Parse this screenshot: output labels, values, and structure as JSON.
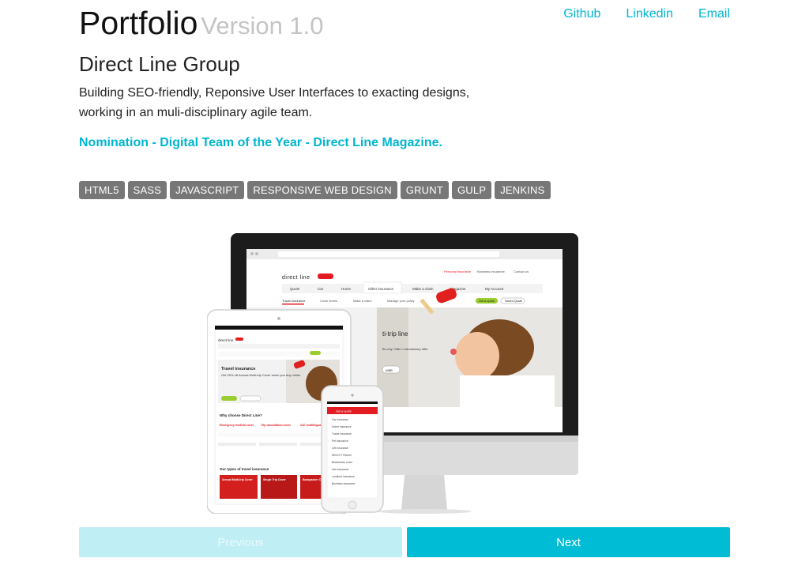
{
  "header": {
    "title": "Portfolio",
    "version": "Version 1.0",
    "links": [
      "Github",
      "Linkedin",
      "Email"
    ]
  },
  "project": {
    "company": "Direct Line Group",
    "description": "Building SEO-friendly, Reponsive User Interfaces to exacting designs, working in an muli-disciplinary agile team.",
    "award": "Nomination - Digital Team of the Year - Direct Line Magazine.",
    "tags": [
      "HTML5",
      "SASS",
      "JAVASCRIPT",
      "RESPONSIVE WEB DESIGN",
      "GRUNT",
      "GULP",
      "JENKINS"
    ]
  },
  "mockup": {
    "logo": "direct line",
    "nav": [
      "Quote",
      "Car",
      "Home",
      "Other insurance",
      "Make a claim",
      "Magazine",
      "My Account"
    ],
    "subnav": [
      "Travel insurance",
      "Cover levels",
      "Make a claim",
      "Manage your policy"
    ],
    "top_links": [
      "Personal insurance",
      "Business insurance",
      "Contact us"
    ],
    "get_quote": "Get a quote",
    "saved_quote": "Saved Quote",
    "hero_fragment": "ti-trip\nline",
    "hero_offer": "ffs only. Offer\nn introductory offer",
    "hero_btn": "uote",
    "tablet": {
      "hero_title": "Travel insurance",
      "hero_text": "Get 25% off Annual Multi-trip Cover when you buy online",
      "why_heading": "Why choose Direct Line?",
      "features": [
        "Emergency medical cover",
        "Trip cancellation cover",
        "24/7 multilingual assistance"
      ],
      "types_heading": "Our types of travel insurance",
      "types": [
        "Annual Multi-trip Cover",
        "Single Trip Cover",
        "Backpacker Cover"
      ]
    },
    "phone": {
      "header": "Get a quote",
      "items": [
        "Car insurance",
        "Home insurance",
        "Travel insurance",
        "Pet insurance",
        "Life insurance",
        "SELECT Partner",
        "Breakdown cover",
        "Van insurance",
        "Landlord insurance",
        "Business insurance"
      ]
    }
  },
  "pagination": {
    "prev_label": "Previous",
    "next_label": "Next"
  },
  "colors": {
    "accent": "#00b5d1",
    "tag_bg": "#777777",
    "brand_red": "#e31c23"
  }
}
